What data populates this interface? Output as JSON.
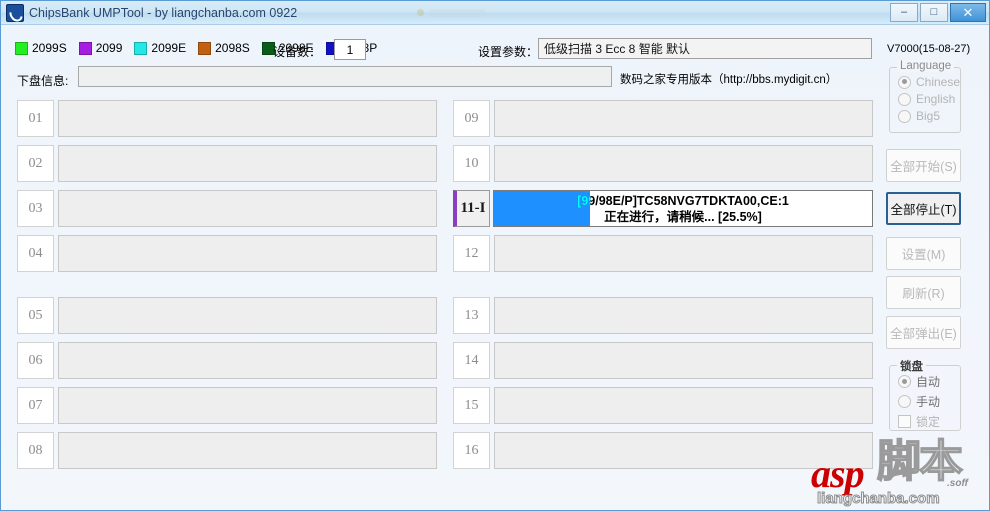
{
  "window": {
    "title": "ChipsBank UMPTool - by liangchanba.com 0922",
    "app_icon": "chipsbank-logo-icon",
    "minimize_label": "–",
    "maximize_label": "□",
    "close_label": "✕"
  },
  "toolbar": {
    "legend": [
      {
        "label": "2099S",
        "color": "#22ee22"
      },
      {
        "label": "2099",
        "color": "#a61ee0"
      },
      {
        "label": "2099E",
        "color": "#22e8e8"
      },
      {
        "label": "2098S",
        "color": "#c06010"
      },
      {
        "label": "2098E",
        "color": "#0a5c1a"
      },
      {
        "label": "2098P",
        "color": "#1010c8"
      }
    ],
    "device_count_label": "设备数：",
    "device_count_value": "1",
    "param_label": "设置参数：",
    "param_value": "低级扫描 3 Ecc 8 智能 默认",
    "version": "V7000(15-08-27)",
    "disk_info_label": "下盘信息:",
    "disk_info_value": "",
    "site_text": "数码之家专用版本（http://bbs.mydigit.cn）"
  },
  "slots_left": [
    {
      "num": "01",
      "text": "",
      "active": false
    },
    {
      "num": "02",
      "text": "",
      "active": false
    },
    {
      "num": "03",
      "text": "",
      "active": false
    },
    {
      "num": "04",
      "text": "",
      "active": false
    },
    {
      "num": "05",
      "text": "",
      "active": false
    },
    {
      "num": "06",
      "text": "",
      "active": false
    },
    {
      "num": "07",
      "text": "",
      "active": false
    },
    {
      "num": "08",
      "text": "",
      "active": false
    }
  ],
  "slots_right": [
    {
      "num": "09",
      "text": "",
      "active": false
    },
    {
      "num": "10",
      "text": "",
      "active": false
    },
    {
      "num": "11-I",
      "active": true,
      "line1": "[99/98E/P]TC58NVG7TDKTA00,CE:1",
      "line2": "正在进行，请稍候... [25.5%]",
      "progress_percent": 25.5,
      "progress_color": "#1e90ff",
      "progress_text_color": "#00ffff",
      "marker_color": "#8a3fc0"
    },
    {
      "num": "12",
      "text": "",
      "active": false
    },
    {
      "num": "13",
      "text": "",
      "active": false
    },
    {
      "num": "14",
      "text": "",
      "active": false
    },
    {
      "num": "15",
      "text": "",
      "active": false
    },
    {
      "num": "16",
      "text": "",
      "active": false
    }
  ],
  "sidebar": {
    "language_group_title": "Language",
    "language_options": [
      {
        "label": "Chinese",
        "selected": true
      },
      {
        "label": "English",
        "selected": false
      },
      {
        "label": "Big5",
        "selected": false
      }
    ],
    "buttons": [
      {
        "label": "全部开始(S)",
        "primary": false
      },
      {
        "label": "全部停止(T)",
        "primary": true
      },
      {
        "label": "设置(M)",
        "primary": false
      },
      {
        "label": "刷新(R)",
        "primary": false
      },
      {
        "label": "全部弹出(E)",
        "primary": false
      }
    ],
    "lock_group_title": "锁盘",
    "lock_options": [
      {
        "label": "自动",
        "selected": true
      },
      {
        "label": "手动",
        "selected": false
      }
    ],
    "lock_checkbox_label": "锁定"
  },
  "watermark": {
    "asp": "asp",
    "cn": "脚本",
    "soff": ".soff",
    "bottom": "liangchanba.com"
  }
}
